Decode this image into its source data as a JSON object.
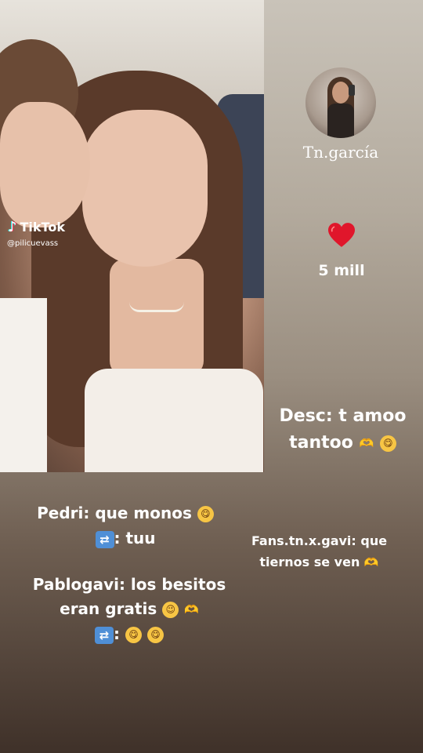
{
  "photo": {
    "watermark_brand": "TikTok",
    "watermark_user": "@pilicuevass"
  },
  "profile": {
    "name": "Tn.garcía"
  },
  "reaction": {
    "likes": "5 mill",
    "heart_color": "#e0162b"
  },
  "caption": {
    "line1": "Desc: t amoo",
    "line2": "tantoo"
  },
  "comments": [
    {
      "line1": "Pedri: que monos",
      "reply": ": tuu"
    },
    {
      "line1": "Fans.tn.x.gavi: que",
      "line2": "tiernos se ven"
    },
    {
      "line1": "Pablogavi: los besitos",
      "line2": "eran gratis",
      "reply": ":"
    }
  ],
  "icons": {
    "repost": "repost-icon",
    "heart": "heart-icon",
    "smile": "yum-face-emoji",
    "wink": "wink-face-emoji",
    "hands": "heart-hands-emoji"
  }
}
